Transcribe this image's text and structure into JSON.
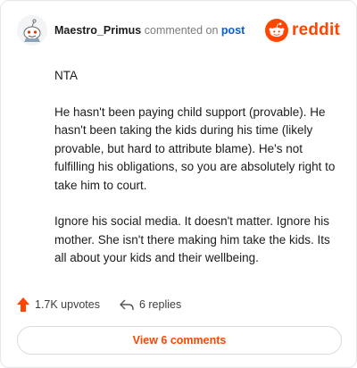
{
  "header": {
    "username": "Maestro_Primus",
    "commented_on": "commented on",
    "post_link": "post",
    "brand": "reddit",
    "avatar_icon": "snoo-avatar-icon",
    "brand_icon": "reddit-alien-icon"
  },
  "comment": {
    "paragraphs": [
      "NTA",
      "He hasn't been paying child support (provable). He hasn't been taking the kids during his time (likely provable, but hard to attribute blame). He's not fulfilling his obligations, so you are absolutely right to take him to court.",
      "Ignore his social media. It doesn't matter. Ignore his mother. She isn't there making him take the kids. Its all about your kids and their wellbeing."
    ]
  },
  "actions": {
    "upvotes": "1.7K upvotes",
    "replies": "6 replies",
    "upvote_icon": "upvote-arrow-icon",
    "reply_icon": "reply-arrow-icon"
  },
  "view_button": "View 6 comments",
  "colors": {
    "brand": "#ff4500",
    "link": "#0a5bd6",
    "muted": "#7c7c7c"
  }
}
